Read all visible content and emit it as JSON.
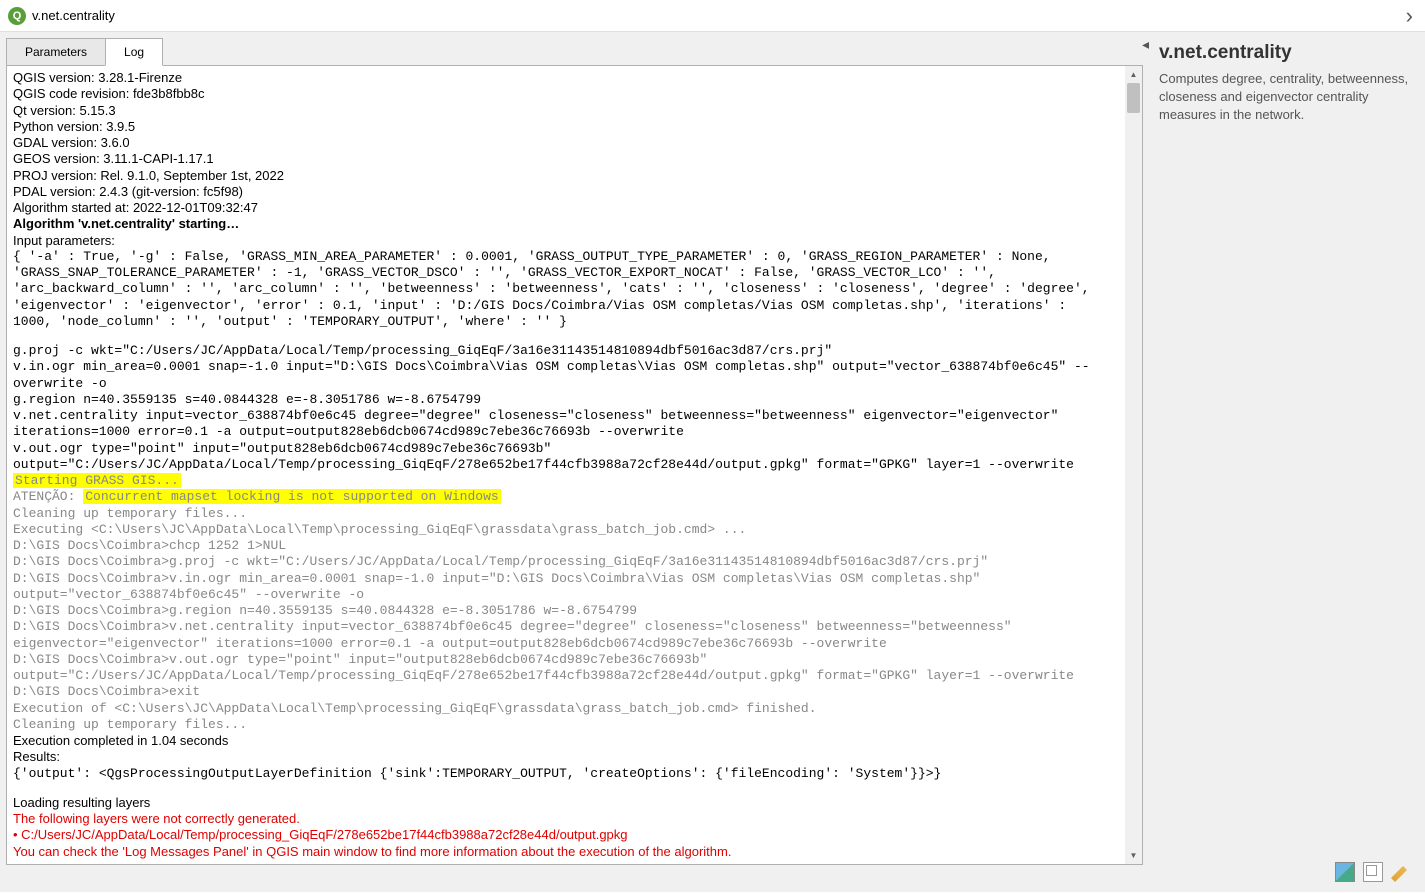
{
  "window": {
    "title": "v.net.centrality"
  },
  "tabs": {
    "parameters": "Parameters",
    "log": "Log"
  },
  "log": {
    "l1": "QGIS version: 3.28.1-Firenze",
    "l2": "QGIS code revision: fde3b8fbb8c",
    "l3": "Qt version: 5.15.3",
    "l4": "Python version: 3.9.5",
    "l5": "GDAL version: 3.6.0",
    "l6": "GEOS version: 3.11.1-CAPI-1.17.1",
    "l7": "PROJ version: Rel. 9.1.0, September 1st, 2022",
    "l8": "PDAL version: 2.4.3 (git-version: fc5f98)",
    "l9": "Algorithm started at: 2022-12-01T09:32:47",
    "l10": "Algorithm 'v.net.centrality' starting…",
    "l11": "Input parameters:",
    "l12": "{ '-a' : True, '-g' : False, 'GRASS_MIN_AREA_PARAMETER' : 0.0001, 'GRASS_OUTPUT_TYPE_PARAMETER' : 0, 'GRASS_REGION_PARAMETER' : None,",
    "l13": "'GRASS_SNAP_TOLERANCE_PARAMETER' : -1, 'GRASS_VECTOR_DSCO' : '', 'GRASS_VECTOR_EXPORT_NOCAT' : False, 'GRASS_VECTOR_LCO' : '',",
    "l14": "'arc_backward_column' : '', 'arc_column' : '', 'betweenness' : 'betweenness', 'cats' : '', 'closeness' : 'closeness', 'degree' : 'degree',",
    "l15": "'eigenvector' : 'eigenvector', 'error' : 0.1, 'input' : 'D:/GIS Docs/Coimbra/Vias OSM completas/Vias OSM completas.shp', 'iterations' :",
    "l16": "1000, 'node_column' : '', 'output' : 'TEMPORARY_OUTPUT', 'where' : '' }",
    "l17": "g.proj -c wkt=\"C:/Users/JC/AppData/Local/Temp/processing_GiqEqF/3a16e31143514810894dbf5016ac3d87/crs.prj\"",
    "l18": "v.in.ogr min_area=0.0001 snap=-1.0 input=\"D:\\GIS Docs\\Coimbra\\Vias OSM completas\\Vias OSM completas.shp\" output=\"vector_638874bf0e6c45\" --overwrite -o",
    "l19": "g.region n=40.3559135 s=40.0844328 e=-8.3051786 w=-8.6754799",
    "l20": "v.net.centrality input=vector_638874bf0e6c45 degree=\"degree\" closeness=\"closeness\" betweenness=\"betweenness\" eigenvector=\"eigenvector\" iterations=1000 error=0.1 -a output=output828eb6dcb0674cd989c7ebe36c76693b --overwrite",
    "l21": "v.out.ogr type=\"point\" input=\"output828eb6dcb0674cd989c7ebe36c76693b\" output=\"C:/Users/JC/AppData/Local/Temp/processing_GiqEqF/278e652be17f44cfb3988a72cf28e44d/output.gpkg\" format=\"GPKG\" layer=1 --overwrite",
    "l22": "Starting GRASS GIS...",
    "l23a": "ATENÇÃO: ",
    "l23b": "Concurrent mapset locking is not supported on Windows",
    "l24": "Cleaning up temporary files...",
    "l25": "Executing <C:\\Users\\JC\\AppData\\Local\\Temp\\processing_GiqEqF\\grassdata\\grass_batch_job.cmd> ...",
    "l26": "D:\\GIS Docs\\Coimbra>chcp 1252 1>NUL",
    "l27": "D:\\GIS Docs\\Coimbra>g.proj -c wkt=\"C:/Users/JC/AppData/Local/Temp/processing_GiqEqF/3a16e31143514810894dbf5016ac3d87/crs.prj\"",
    "l28": "D:\\GIS Docs\\Coimbra>v.in.ogr min_area=0.0001 snap=-1.0 input=\"D:\\GIS Docs\\Coimbra\\Vias OSM completas\\Vias OSM completas.shp\" output=\"vector_638874bf0e6c45\" --overwrite -o",
    "l29": "D:\\GIS Docs\\Coimbra>g.region n=40.3559135 s=40.0844328 e=-8.3051786 w=-8.6754799",
    "l30": "D:\\GIS Docs\\Coimbra>v.net.centrality input=vector_638874bf0e6c45 degree=\"degree\" closeness=\"closeness\" betweenness=\"betweenness\" eigenvector=\"eigenvector\" iterations=1000 error=0.1 -a output=output828eb6dcb0674cd989c7ebe36c76693b --overwrite",
    "l31": "D:\\GIS Docs\\Coimbra>v.out.ogr type=\"point\" input=\"output828eb6dcb0674cd989c7ebe36c76693b\" output=\"C:/Users/JC/AppData/Local/Temp/processing_GiqEqF/278e652be17f44cfb3988a72cf28e44d/output.gpkg\" format=\"GPKG\" layer=1 --overwrite",
    "l32": "D:\\GIS Docs\\Coimbra>exit",
    "l33": "Execution of <C:\\Users\\JC\\AppData\\Local\\Temp\\processing_GiqEqF\\grassdata\\grass_batch_job.cmd> finished.",
    "l34": "Cleaning up temporary files...",
    "l35": "Execution completed in 1.04 seconds",
    "l36": "Results:",
    "l37": "{'output': <QgsProcessingOutputLayerDefinition {'sink':TEMPORARY_OUTPUT, 'createOptions': {'fileEncoding': 'System'}}>}",
    "l38": "Loading resulting layers",
    "l39": "The following layers were not correctly generated.",
    "l40": "• C:/Users/JC/AppData/Local/Temp/processing_GiqEqF/278e652be17f44cfb3988a72cf28e44d/output.gpkg",
    "l41": "You can check the 'Log Messages Panel' in QGIS main window to find more information about the execution of the algorithm."
  },
  "side": {
    "title": "v.net.centrality",
    "desc": "Computes degree, centrality, betweenness, closeness and eigenvector centrality measures in the network."
  }
}
